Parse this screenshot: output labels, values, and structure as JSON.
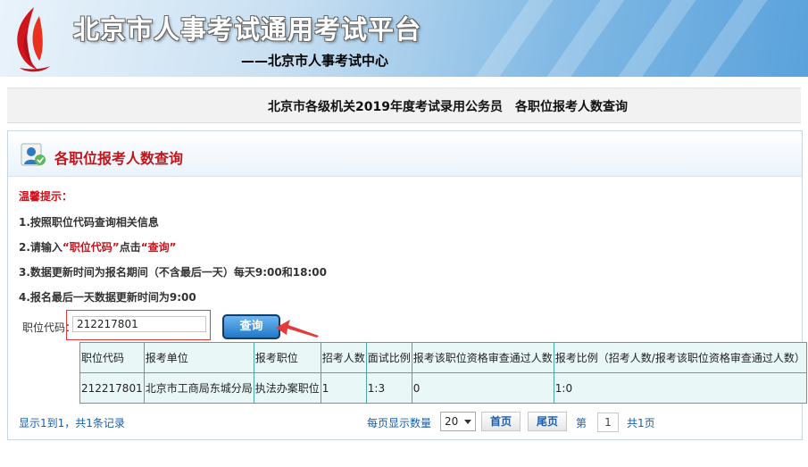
{
  "header": {
    "title": "北京市人事考试通用考试平台",
    "subtitle": "——北京市人事考试中心"
  },
  "subtitle_bar": {
    "heading": "北京市各级机关2019年度考试录用公务员　各职位报考人数查询"
  },
  "panel": {
    "title": "各职位报考人数查询",
    "tips": {
      "heading": "温馨提示：",
      "line1": "1.按照职位代码查询相关信息",
      "line2_a": "2.请输入",
      "line2_b": "“职位代码”",
      "line2_c": "点击",
      "line2_d": "“查询”",
      "line3": "3.数据更新时间为报名期间（不含最后一天）每天9:00和18:00",
      "line4": "4.报名最后一天数据更新时间为9:00"
    },
    "query": {
      "label": "职位代码：",
      "value": "212217801",
      "button": "查询"
    }
  },
  "table": {
    "headers": [
      "职位代码",
      "报考单位",
      "报考职位",
      "招考人数",
      "面试比例",
      "报考该职位资格审查通过人数",
      "报考比例（招考人数/报考该职位资格审查通过人数）"
    ],
    "rows": [
      [
        "212217801",
        "北京市工商局东城分局",
        "执法办案职位",
        "1",
        "1:3",
        "0",
        "1:0"
      ]
    ]
  },
  "pager": {
    "summary": "显示1到1，共1条记录",
    "per_page_label": "每页显示数量",
    "per_page_value": "20",
    "first_button": "首页",
    "last_button": "尾页",
    "page_label": "第",
    "page_value": "1",
    "total_pages": "共1页"
  },
  "colors": {
    "accent_red": "#d0101a",
    "link_blue": "#1a5ea8",
    "button_blue": "#1f78c8",
    "table_border": "#4aa8a8"
  }
}
